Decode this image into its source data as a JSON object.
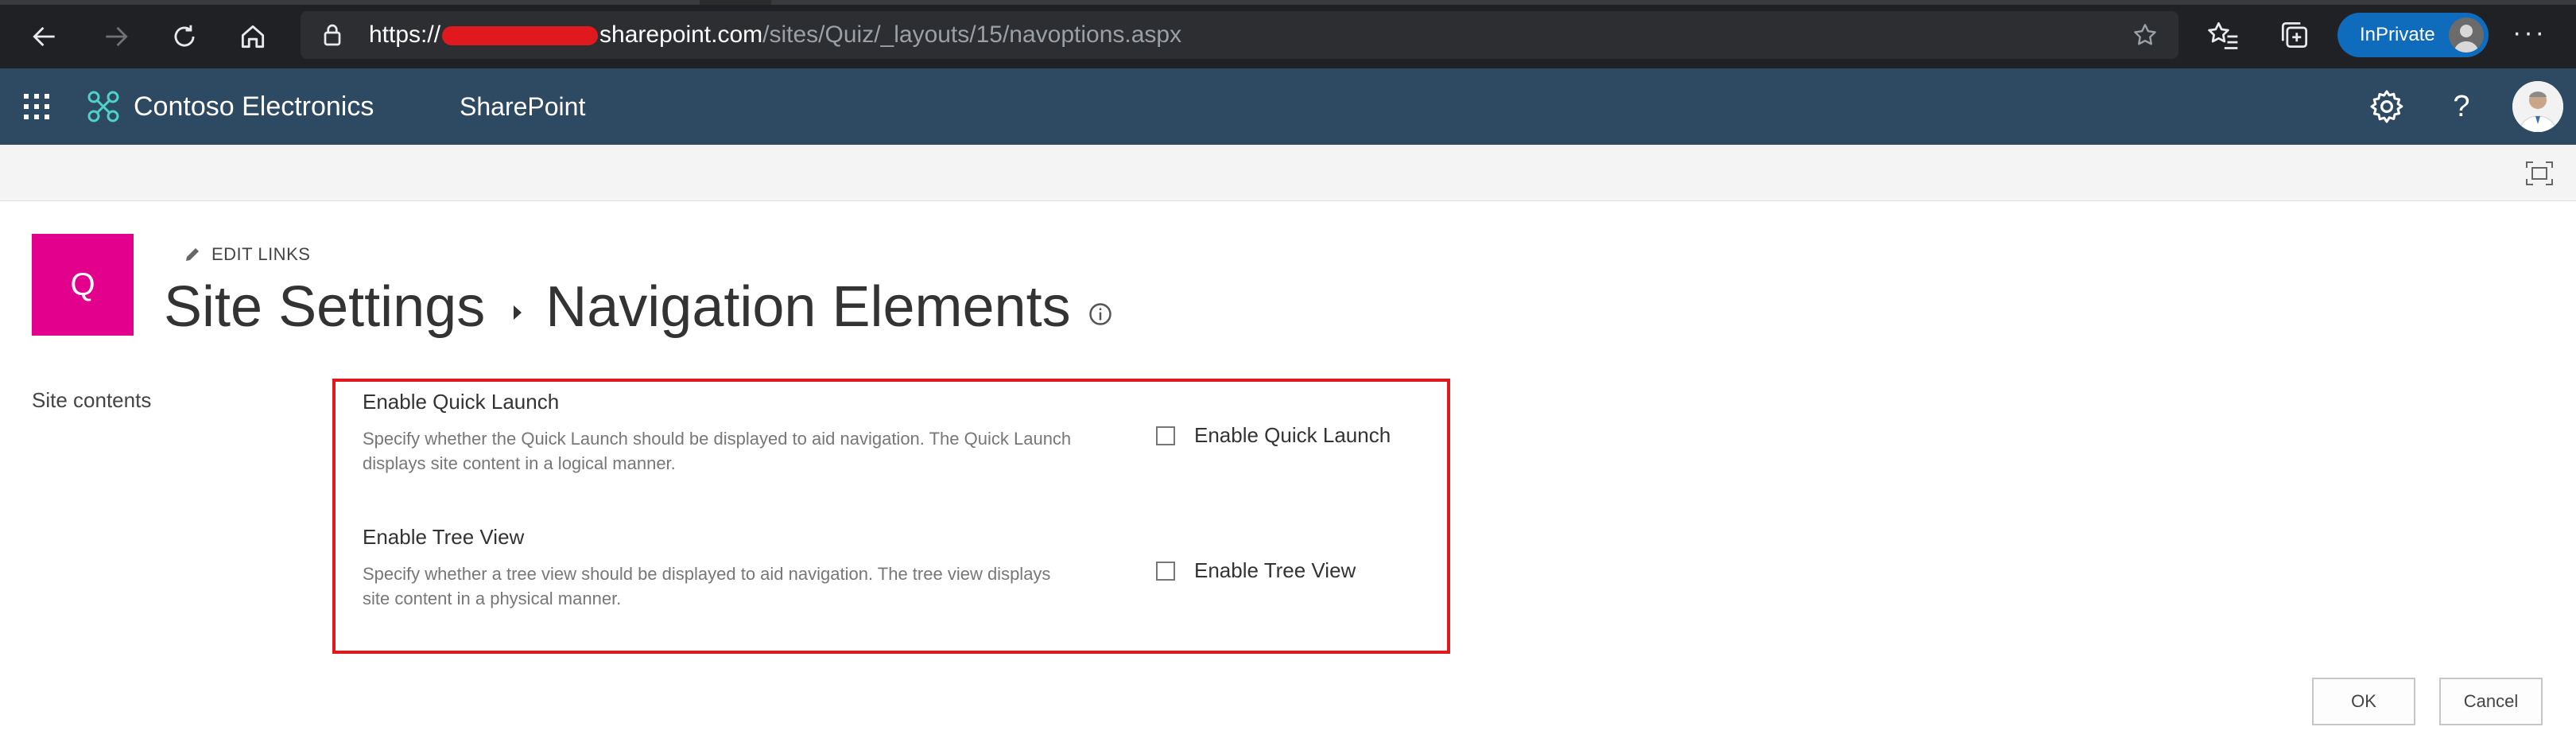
{
  "browser": {
    "url_prefix": "https://",
    "url_host": "sharepoint.com",
    "url_path": "/sites/Quiz/_layouts/15/navoptions.aspx",
    "inprivate_label": "InPrivate",
    "more_label": "···"
  },
  "suitebar": {
    "brand": "Contoso Electronics",
    "app": "SharePoint",
    "help": "?",
    "color": "#2e4a62"
  },
  "site": {
    "logo_letter": "Q",
    "logo_color": "#e3008c",
    "edit_links": "EDIT LINKS",
    "title_parent": "Site Settings",
    "title_current": "Navigation Elements"
  },
  "left_nav": {
    "items": [
      "Site contents"
    ]
  },
  "settings": {
    "quick_launch": {
      "title": "Enable Quick Launch",
      "desc": "Specify whether the Quick Launch should be displayed to aid navigation.  The Quick Launch displays site content in a logical manner.",
      "checkbox_label": "Enable Quick Launch",
      "checked": false
    },
    "tree_view": {
      "title": "Enable Tree View",
      "desc": "Specify whether a tree view should be displayed to aid navigation.  The tree view displays site content in a physical manner.",
      "checkbox_label": "Enable Tree View",
      "checked": false
    },
    "highlight_color": "#e0191f"
  },
  "buttons": {
    "ok": "OK",
    "cancel": "Cancel"
  }
}
